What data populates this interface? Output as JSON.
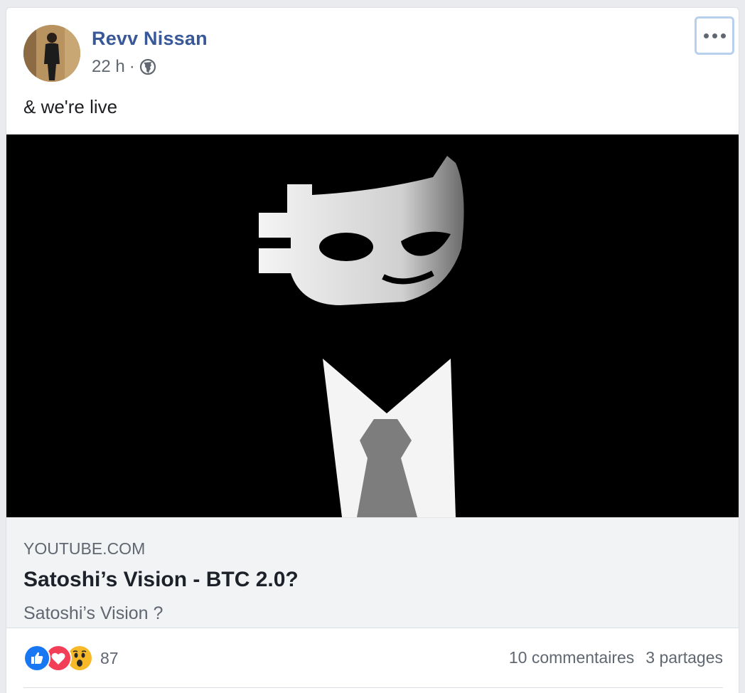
{
  "post": {
    "author": "Revv Nissan",
    "time": "22 h",
    "separator": "·",
    "text": "& we're live",
    "privacy_icon": "globe-icon",
    "more_icon": "more-options-icon"
  },
  "link": {
    "domain": "YOUTUBE.COM",
    "title": "Satoshi’s Vision - BTC 2.0?",
    "description": "Satoshi’s Vision ?"
  },
  "footer": {
    "reactions": [
      "like-reaction-icon",
      "love-reaction-icon",
      "wow-reaction-icon"
    ],
    "reaction_count": "87",
    "comments": "10 commentaires",
    "shares": "3 partages"
  },
  "colors": {
    "author": "#385898",
    "meta": "#606770",
    "like": "#1877f2",
    "love": "#f33e58",
    "wow": "#f7b928",
    "link_bg": "#f2f3f5"
  }
}
